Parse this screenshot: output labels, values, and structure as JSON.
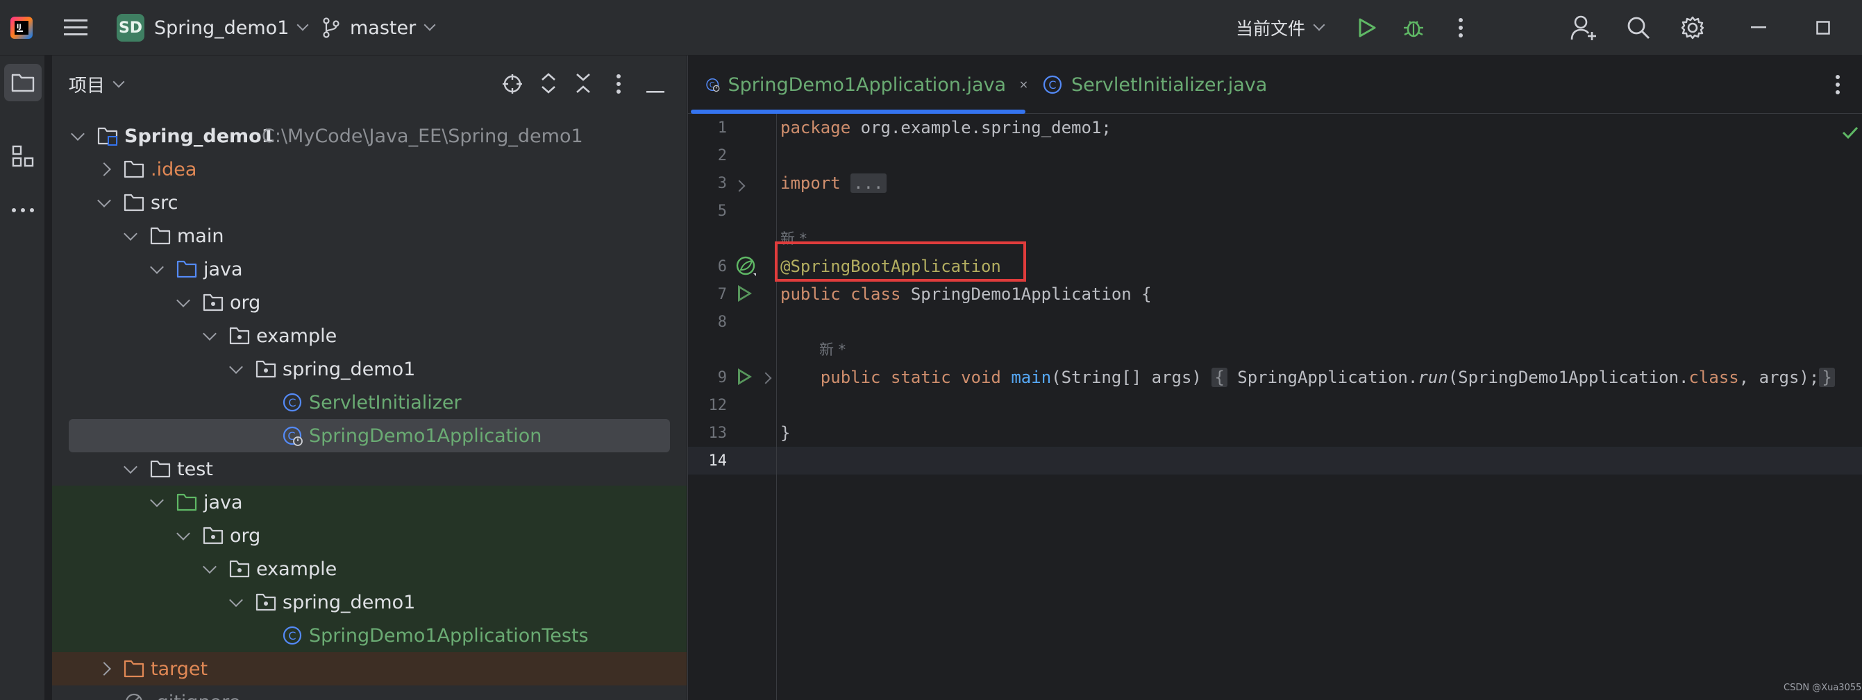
{
  "titlebar": {
    "project_badge": "SD",
    "project_name": "Spring_demo1",
    "branch": "master",
    "run_config": "当前文件"
  },
  "project_panel": {
    "title": "项目",
    "tree": [
      {
        "label": "Spring_demo1",
        "path": "C:\\MyCode\\Java_EE\\Spring_demo1"
      },
      {
        "label": ".idea"
      },
      {
        "label": "src"
      },
      {
        "label": "main"
      },
      {
        "label": "java"
      },
      {
        "label": "org"
      },
      {
        "label": "example"
      },
      {
        "label": "spring_demo1"
      },
      {
        "label": "ServletInitializer"
      },
      {
        "label": "SpringDemo1Application"
      },
      {
        "label": "test"
      },
      {
        "label": "java"
      },
      {
        "label": "org"
      },
      {
        "label": "example"
      },
      {
        "label": "spring_demo1"
      },
      {
        "label": "SpringDemo1ApplicationTests"
      },
      {
        "label": "target"
      },
      {
        "label": ".gitignore"
      }
    ]
  },
  "editor": {
    "tabs": [
      {
        "label": "SpringDemo1Application.java",
        "active": true
      },
      {
        "label": "ServletInitializer.java",
        "active": false
      }
    ],
    "line_numbers": [
      "1",
      "2",
      "3",
      "5",
      "6",
      "7",
      "8",
      "9",
      "12",
      "13",
      "14"
    ],
    "code": {
      "l1_kw": "package",
      "l1_rest": " org.example.spring_demo1;",
      "l3_kw": "import",
      "l3_fold": "...",
      "hint1": "新 *",
      "l6_ann": "@SpringBootApplication",
      "l7_kw": "public class",
      "l7_rest": " SpringDemo1Application {",
      "hint2": "新 *",
      "l9_kw": "public static void",
      "l9_fn": "main",
      "l9_args": "(String[] args)",
      "l9_brace_open": "{",
      "l9_body1": " SpringApplication.",
      "l9_run": "run",
      "l9_body2": "(SpringDemo1Application.",
      "l9_class": "class",
      "l9_body3": ", args);",
      "l9_brace_close": "}",
      "l13": "}"
    }
  },
  "watermark": "CSDN @Xua3055",
  "colors": {
    "accent": "#3574f0",
    "highlight_box": "#e03c3c",
    "green_text": "#6aab73"
  }
}
